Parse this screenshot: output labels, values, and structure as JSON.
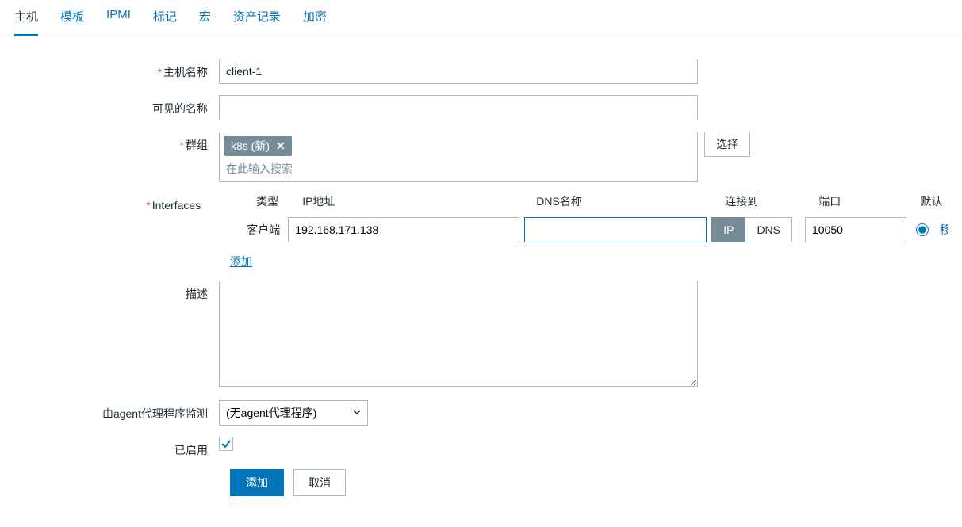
{
  "tabs": {
    "host": "主机",
    "templates": "模板",
    "ipmi": "IPMI",
    "tags": "标记",
    "macros": "宏",
    "inventory": "资产记录",
    "encryption": "加密"
  },
  "labels": {
    "hostname": "主机名称",
    "visible_name": "可见的名称",
    "groups": "群组",
    "interfaces": "Interfaces",
    "description": "描述",
    "monitored_by": "由agent代理程序监测",
    "enabled": "已启用"
  },
  "form": {
    "hostname_value": "client-1",
    "visible_name_value": "",
    "group_tag": "k8s (新)",
    "group_search_placeholder": "在此输入搜索",
    "select_button": "选择",
    "description_value": "",
    "proxy_value": "(无agent代理程序)",
    "enabled_checked": true
  },
  "interfaces": {
    "headers": {
      "type": "类型",
      "ip": "IP地址",
      "dns": "DNS名称",
      "connect_to": "连接到",
      "port": "端口",
      "default": "默认"
    },
    "row": {
      "type_label": "客户端",
      "ip_value": "192.168.171.138",
      "dns_value": "",
      "ip_btn": "IP",
      "dns_btn": "DNS",
      "port_value": "10050"
    },
    "add_link": "添加"
  },
  "buttons": {
    "submit": "添加",
    "cancel": "取消"
  }
}
